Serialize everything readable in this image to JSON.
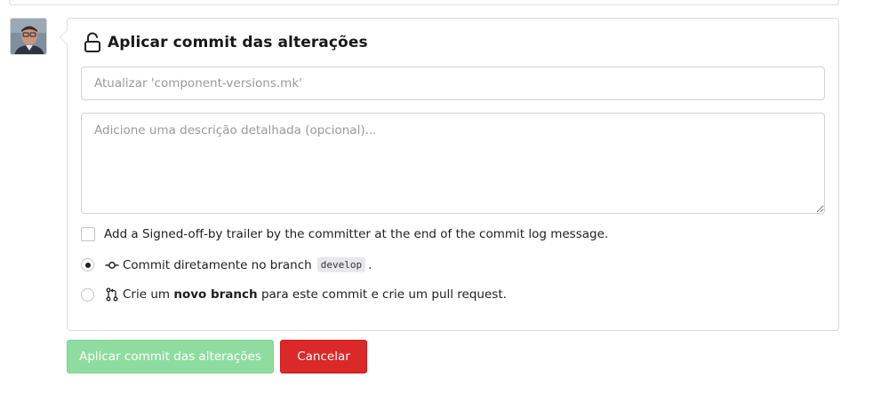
{
  "avatar": {
    "alt": "user avatar"
  },
  "commit_form": {
    "title": "Aplicar commit das alterações",
    "summary_placeholder": "Atualizar 'component-versions.mk'",
    "summary_value": "",
    "description_placeholder": "Adicione uma descrição detalhada (opcional)...",
    "description_value": "",
    "signoff_label": "Add a Signed-off-by trailer by the committer at the end of the commit log message.",
    "signoff_checked": false,
    "commit_direct": {
      "label_prefix": "Commit diretamente no branch",
      "branch": "develop",
      "label_suffix": ".",
      "selected": true,
      "icon": "git-commit-icon"
    },
    "new_branch": {
      "label_prefix": "Crie um",
      "label_bold": "novo branch",
      "label_suffix": "para este commit e crie um pull request.",
      "selected": false,
      "icon": "git-pull-request-icon"
    }
  },
  "actions": {
    "commit_label": "Aplicar commit das alterações",
    "cancel_label": "Cancelar"
  },
  "colors": {
    "commit_button": "#8fdca0",
    "cancel_button": "#db2828",
    "border": "#dcdcde"
  }
}
